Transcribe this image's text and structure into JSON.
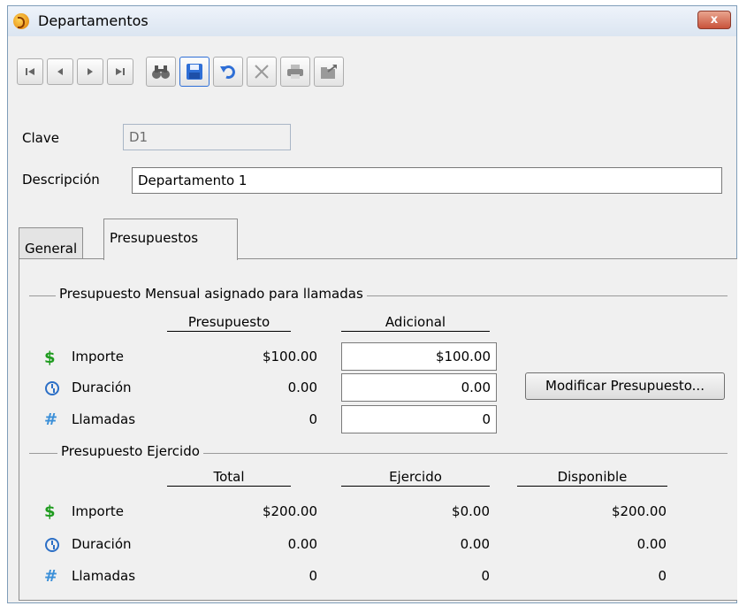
{
  "window": {
    "title": "Departamentos",
    "close_label": "x"
  },
  "toolbar": {
    "buttons": [
      "first-record",
      "previous-record",
      "next-record",
      "last-record",
      "search",
      "save",
      "undo",
      "delete",
      "print",
      "export"
    ]
  },
  "form": {
    "clave_label": "Clave",
    "clave_value": "D1",
    "descripcion_label": "Descripción",
    "descripcion_value": "Departamento 1"
  },
  "tabs": [
    {
      "label": "General",
      "active": false
    },
    {
      "label": "Presupuestos",
      "active": true
    }
  ],
  "mensual": {
    "section_title": "Presupuesto Mensual asignado para llamadas",
    "col_presupuesto": "Presupuesto",
    "col_adicional": "Adicional",
    "rows": [
      {
        "icon": "dollar-icon",
        "label": "Importe",
        "presupuesto": "$100.00",
        "adicional": "$100.00"
      },
      {
        "icon": "clock-icon",
        "label": "Duración",
        "presupuesto": "0.00",
        "adicional": "0.00"
      },
      {
        "icon": "hash-icon",
        "label": "Llamadas",
        "presupuesto": "0",
        "adicional": "0"
      }
    ],
    "modify_button": "Modificar Presupuesto..."
  },
  "ejercido": {
    "section_title": "Presupuesto Ejercido",
    "col_total": "Total",
    "col_ejercido": "Ejercido",
    "col_disponible": "Disponible",
    "rows": [
      {
        "icon": "dollar-icon",
        "label": "Importe",
        "total": "$200.00",
        "ejercido": "$0.00",
        "disponible": "$200.00"
      },
      {
        "icon": "clock-icon",
        "label": "Duración",
        "total": "0.00",
        "ejercido": "0.00",
        "disponible": "0.00"
      },
      {
        "icon": "hash-icon",
        "label": "Llamadas",
        "total": "0",
        "ejercido": "0",
        "disponible": "0"
      }
    ]
  },
  "colors": {
    "dollar": "#1e9b1e",
    "clock": "#2c6fc6",
    "hash": "#3a8fd8",
    "save_active": "#2f6fd6"
  }
}
